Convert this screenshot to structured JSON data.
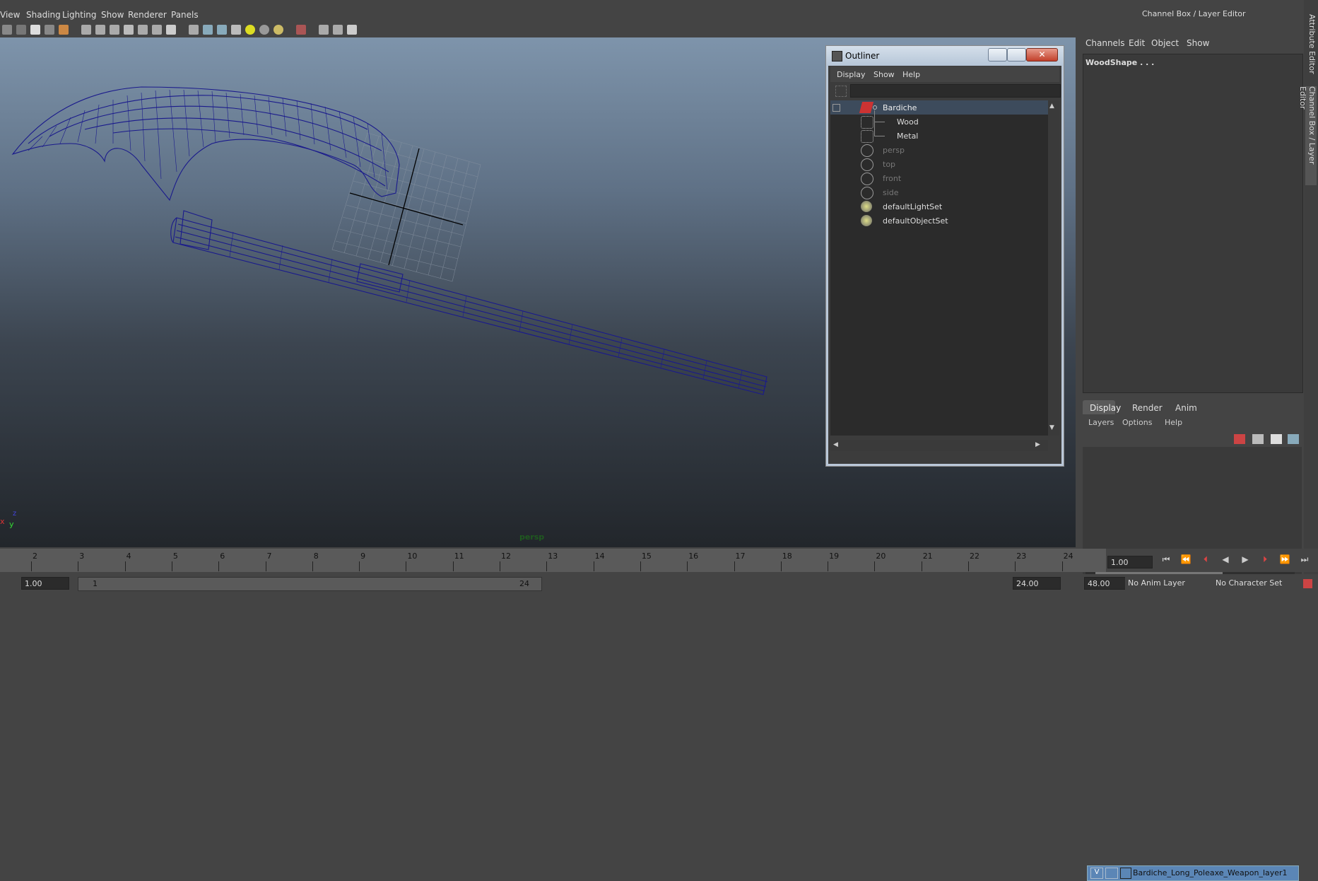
{
  "menubar": {
    "items": [
      "View",
      "Shading",
      "Lighting",
      "Show",
      "Renderer",
      "Panels"
    ]
  },
  "viewport": {
    "camera_label": "persp",
    "axis_x": "x",
    "axis_y": "y",
    "axis_z": "z",
    "wire_color": "#1a1a8c"
  },
  "outliner": {
    "title": "Outliner",
    "menu": [
      "Display",
      "Show",
      "Help"
    ],
    "items": [
      {
        "label": "Bardiche",
        "selected": true,
        "dim": false
      },
      {
        "label": "Wood",
        "selected": false,
        "dim": false
      },
      {
        "label": "Metal",
        "selected": false,
        "dim": false
      },
      {
        "label": "persp",
        "selected": false,
        "dim": true
      },
      {
        "label": "top",
        "selected": false,
        "dim": true
      },
      {
        "label": "front",
        "selected": false,
        "dim": true
      },
      {
        "label": "side",
        "selected": false,
        "dim": true
      },
      {
        "label": "defaultLightSet",
        "selected": false,
        "dim": false
      },
      {
        "label": "defaultObjectSet",
        "selected": false,
        "dim": false
      }
    ],
    "close_glyph": "✕"
  },
  "channelbox": {
    "title": "Channel Box / Layer Editor",
    "menu": [
      "Channels",
      "Edit",
      "Object",
      "Show"
    ],
    "object_name": "WoodShape . . ."
  },
  "layereditor": {
    "tabs": [
      "Display",
      "Render",
      "Anim"
    ],
    "menu": [
      "Layers",
      "Options",
      "Help"
    ],
    "layer_visibility": "V",
    "layer_name": "Bardiche_Long_Poleaxe_Weapon_layer1"
  },
  "side_tabs": [
    "Attribute Editor",
    "Channel Box / Layer Editor"
  ],
  "timeline": {
    "ticks": [
      "2",
      "3",
      "4",
      "5",
      "6",
      "7",
      "8",
      "9",
      "10",
      "11",
      "12",
      "13",
      "14",
      "15",
      "16",
      "17",
      "18",
      "19",
      "20",
      "21",
      "22",
      "23",
      "24"
    ],
    "current_frame": "1.00"
  },
  "rangebar": {
    "start_time": "1.00",
    "range_start": "1",
    "range_end": "24",
    "end_time": "24.00",
    "max_time": "48.00",
    "anim_layer": "No Anim Layer",
    "character_set": "No Character Set"
  }
}
